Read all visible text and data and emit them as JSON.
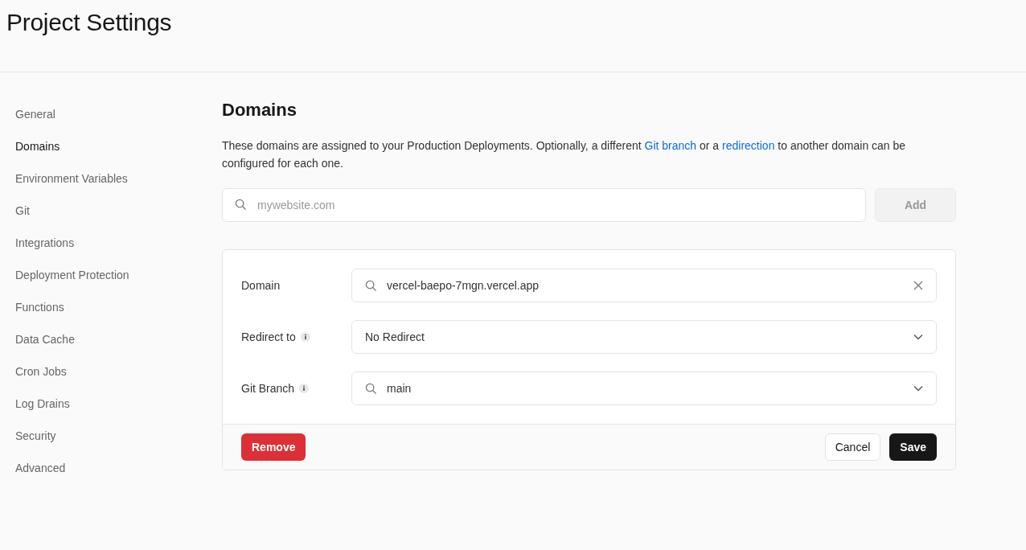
{
  "page_title": "Project Settings",
  "sidebar": {
    "items": [
      {
        "label": "General",
        "selected": false
      },
      {
        "label": "Domains",
        "selected": true
      },
      {
        "label": "Environment Variables",
        "selected": false
      },
      {
        "label": "Git",
        "selected": false
      },
      {
        "label": "Integrations",
        "selected": false
      },
      {
        "label": "Deployment Protection",
        "selected": false
      },
      {
        "label": "Functions",
        "selected": false
      },
      {
        "label": "Data Cache",
        "selected": false
      },
      {
        "label": "Cron Jobs",
        "selected": false
      },
      {
        "label": "Log Drains",
        "selected": false
      },
      {
        "label": "Security",
        "selected": false
      },
      {
        "label": "Advanced",
        "selected": false
      }
    ]
  },
  "section": {
    "title": "Domains",
    "description": [
      {
        "kind": "text",
        "text": "These domains are assigned to your Production Deployments. Optionally, a different "
      },
      {
        "kind": "link",
        "text": "Git branch"
      },
      {
        "kind": "text",
        "text": " or a "
      },
      {
        "kind": "link",
        "text": "redirection"
      },
      {
        "kind": "text",
        "text": " to another domain can be configured for each one."
      }
    ],
    "domain_input": {
      "placeholder": "mywebsite.com"
    },
    "add_button": {
      "label": "Add",
      "disabled": true
    }
  },
  "domain_card": {
    "fields": [
      {
        "label": "Domain",
        "info": false,
        "kind": "search-clear",
        "value": "vercel-baepo-7mgn.vercel.app"
      },
      {
        "label": "Redirect to",
        "info": true,
        "kind": "select",
        "value": "No Redirect"
      },
      {
        "label": "Git Branch",
        "info": true,
        "kind": "search-select",
        "value": "main"
      }
    ],
    "buttons": [
      {
        "label": "Remove",
        "kind": "danger"
      },
      {
        "label": "Cancel",
        "kind": "secondary"
      },
      {
        "label": "Save",
        "kind": "primary"
      }
    ]
  }
}
